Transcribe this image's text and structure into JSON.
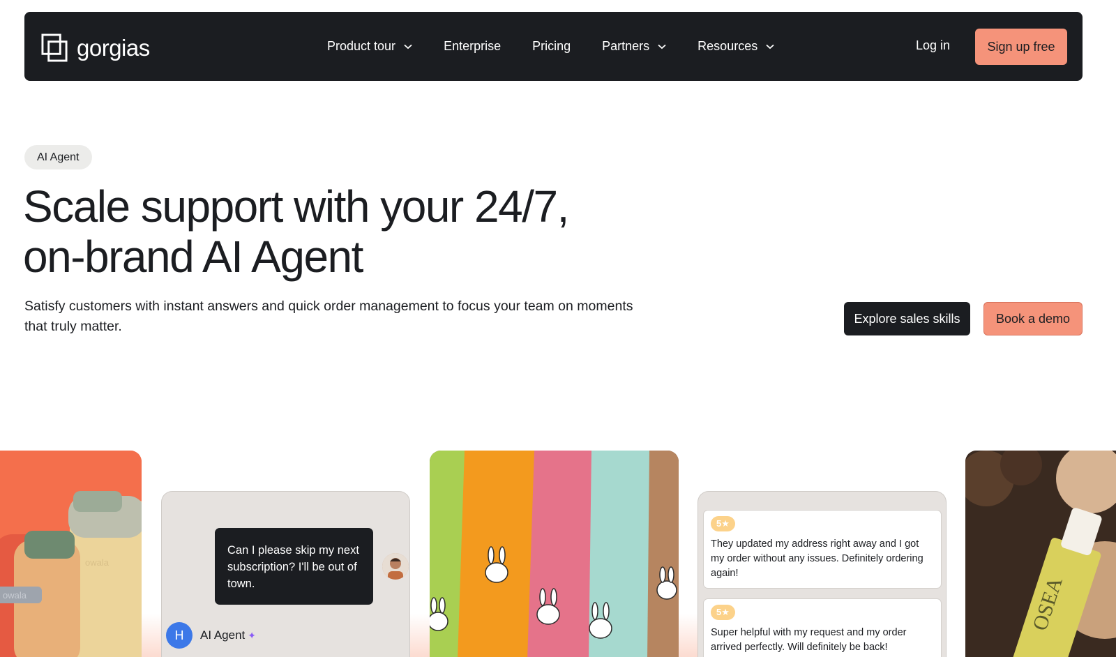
{
  "nav": {
    "brand": "gorgias",
    "links": [
      {
        "label": "Product tour",
        "dropdown": true
      },
      {
        "label": "Enterprise",
        "dropdown": false
      },
      {
        "label": "Pricing",
        "dropdown": false
      },
      {
        "label": "Partners",
        "dropdown": true
      },
      {
        "label": "Resources",
        "dropdown": true
      }
    ],
    "login": "Log in",
    "signup": "Sign up free"
  },
  "hero": {
    "badge": "AI Agent",
    "headline_line1": "Scale support with your 24/7,",
    "headline_line2": "on-brand AI Agent",
    "subtext": "Satisfy customers with instant answers and quick order management to focus your team on moments that truly matter.",
    "cta_primary": "Explore sales skills",
    "cta_secondary": "Book a demo"
  },
  "cards": {
    "chat": {
      "customer_message": "Can I please skip my next subscription? I'll be out of town.",
      "agent_initial": "H",
      "agent_name": "AI Agent",
      "sparkle": "✦"
    },
    "reviews": [
      {
        "rating": "5★",
        "text": "They updated my address right away and I got my order without any issues. Definitely ordering again!"
      },
      {
        "rating": "5★",
        "text": "Super helpful with my request and my order arrived perfectly. Will definitely be back!"
      }
    ],
    "bottle_product_text": "owala",
    "serum_product_text": "OSEA"
  },
  "colors": {
    "dark": "#1b1d21",
    "accent": "#f5937a",
    "badge_bg": "#ececea",
    "agent_blue": "#3c78e8"
  }
}
